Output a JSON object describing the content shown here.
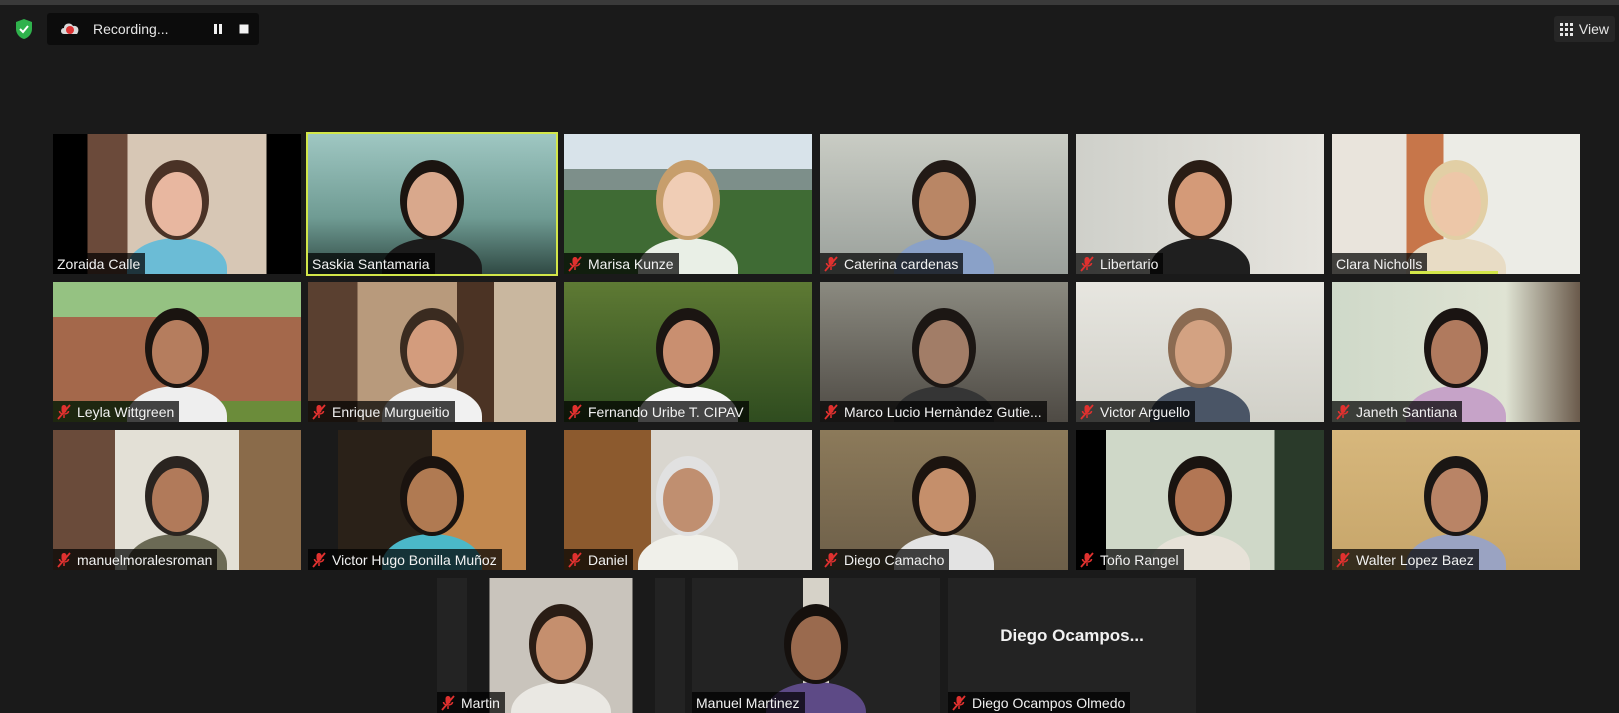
{
  "toolbar": {
    "recording_label": "Recording...",
    "view_label": "View"
  },
  "participants": [
    {
      "name": "Zoraida Calle",
      "muted": false
    },
    {
      "name": "Saskia Santamaria",
      "muted": false,
      "active_speaker": true
    },
    {
      "name": "Marisa Kunze",
      "muted": true
    },
    {
      "name": "Caterina cardenas",
      "muted": true
    },
    {
      "name": "Libertario",
      "muted": true
    },
    {
      "name": "Clara Nicholls",
      "muted": false
    },
    {
      "name": "Leyla Wittgreen",
      "muted": true
    },
    {
      "name": "Enrique Murgueitio",
      "muted": true
    },
    {
      "name": "Fernando Uribe T. CIPAV",
      "muted": true
    },
    {
      "name": "Marco Lucio Hernàndez Gutie...",
      "muted": true
    },
    {
      "name": "Victor Arguello",
      "muted": true
    },
    {
      "name": "Janeth Santiana",
      "muted": true
    },
    {
      "name": "manuelmoralesroman",
      "muted": true
    },
    {
      "name": "Victor Hugo Bonilla Muñoz",
      "muted": true
    },
    {
      "name": "Daniel",
      "muted": true
    },
    {
      "name": "Diego Camacho",
      "muted": true
    },
    {
      "name": "Toño Rangel",
      "muted": true
    },
    {
      "name": "Walter Lopez Baez",
      "muted": true
    },
    {
      "name": "Martin",
      "muted": true
    },
    {
      "name": "Manuel Martinez",
      "muted": false
    },
    {
      "name": "Diego Ocampos Olmedo",
      "muted": true,
      "no_video_label": "Diego  Ocampos..."
    }
  ],
  "colors": {
    "active_border": "#d2e649",
    "mute_icon": "#e0312f",
    "shield": "#2fb24c"
  }
}
